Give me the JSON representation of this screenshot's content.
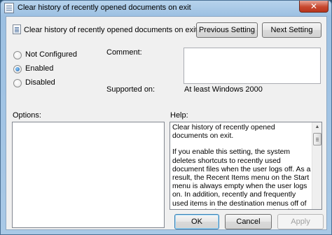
{
  "window": {
    "title": "Clear history of recently opened documents on exit",
    "close_glyph": "✕"
  },
  "header": {
    "policy_title": "Clear history of recently opened documents on exit",
    "previous_setting_label": "Previous Setting",
    "next_setting_label": "Next Setting"
  },
  "state": {
    "options": [
      {
        "label": "Not Configured",
        "selected": false
      },
      {
        "label": "Enabled",
        "selected": true
      },
      {
        "label": "Disabled",
        "selected": false
      }
    ]
  },
  "comment": {
    "label": "Comment:",
    "value": ""
  },
  "supported": {
    "label": "Supported on:",
    "value": "At least Windows 2000"
  },
  "options_panel": {
    "label": "Options:"
  },
  "help_panel": {
    "label": "Help:",
    "paragraphs": [
      "Clear history of recently opened documents on exit.",
      "If you enable this setting, the system deletes shortcuts to recently used document files when the user logs off. As a result, the Recent Items menu on the Start menu is always empty when the user logs on. In addition, recently and frequently used items in the destination menus off of programs in the Start Menu and Taskbar"
    ]
  },
  "footer": {
    "ok_label": "OK",
    "cancel_label": "Cancel",
    "apply_label": "Apply"
  },
  "icons": {
    "window_icon": "policy-document-icon",
    "policy_icon": "policy-document-icon"
  }
}
